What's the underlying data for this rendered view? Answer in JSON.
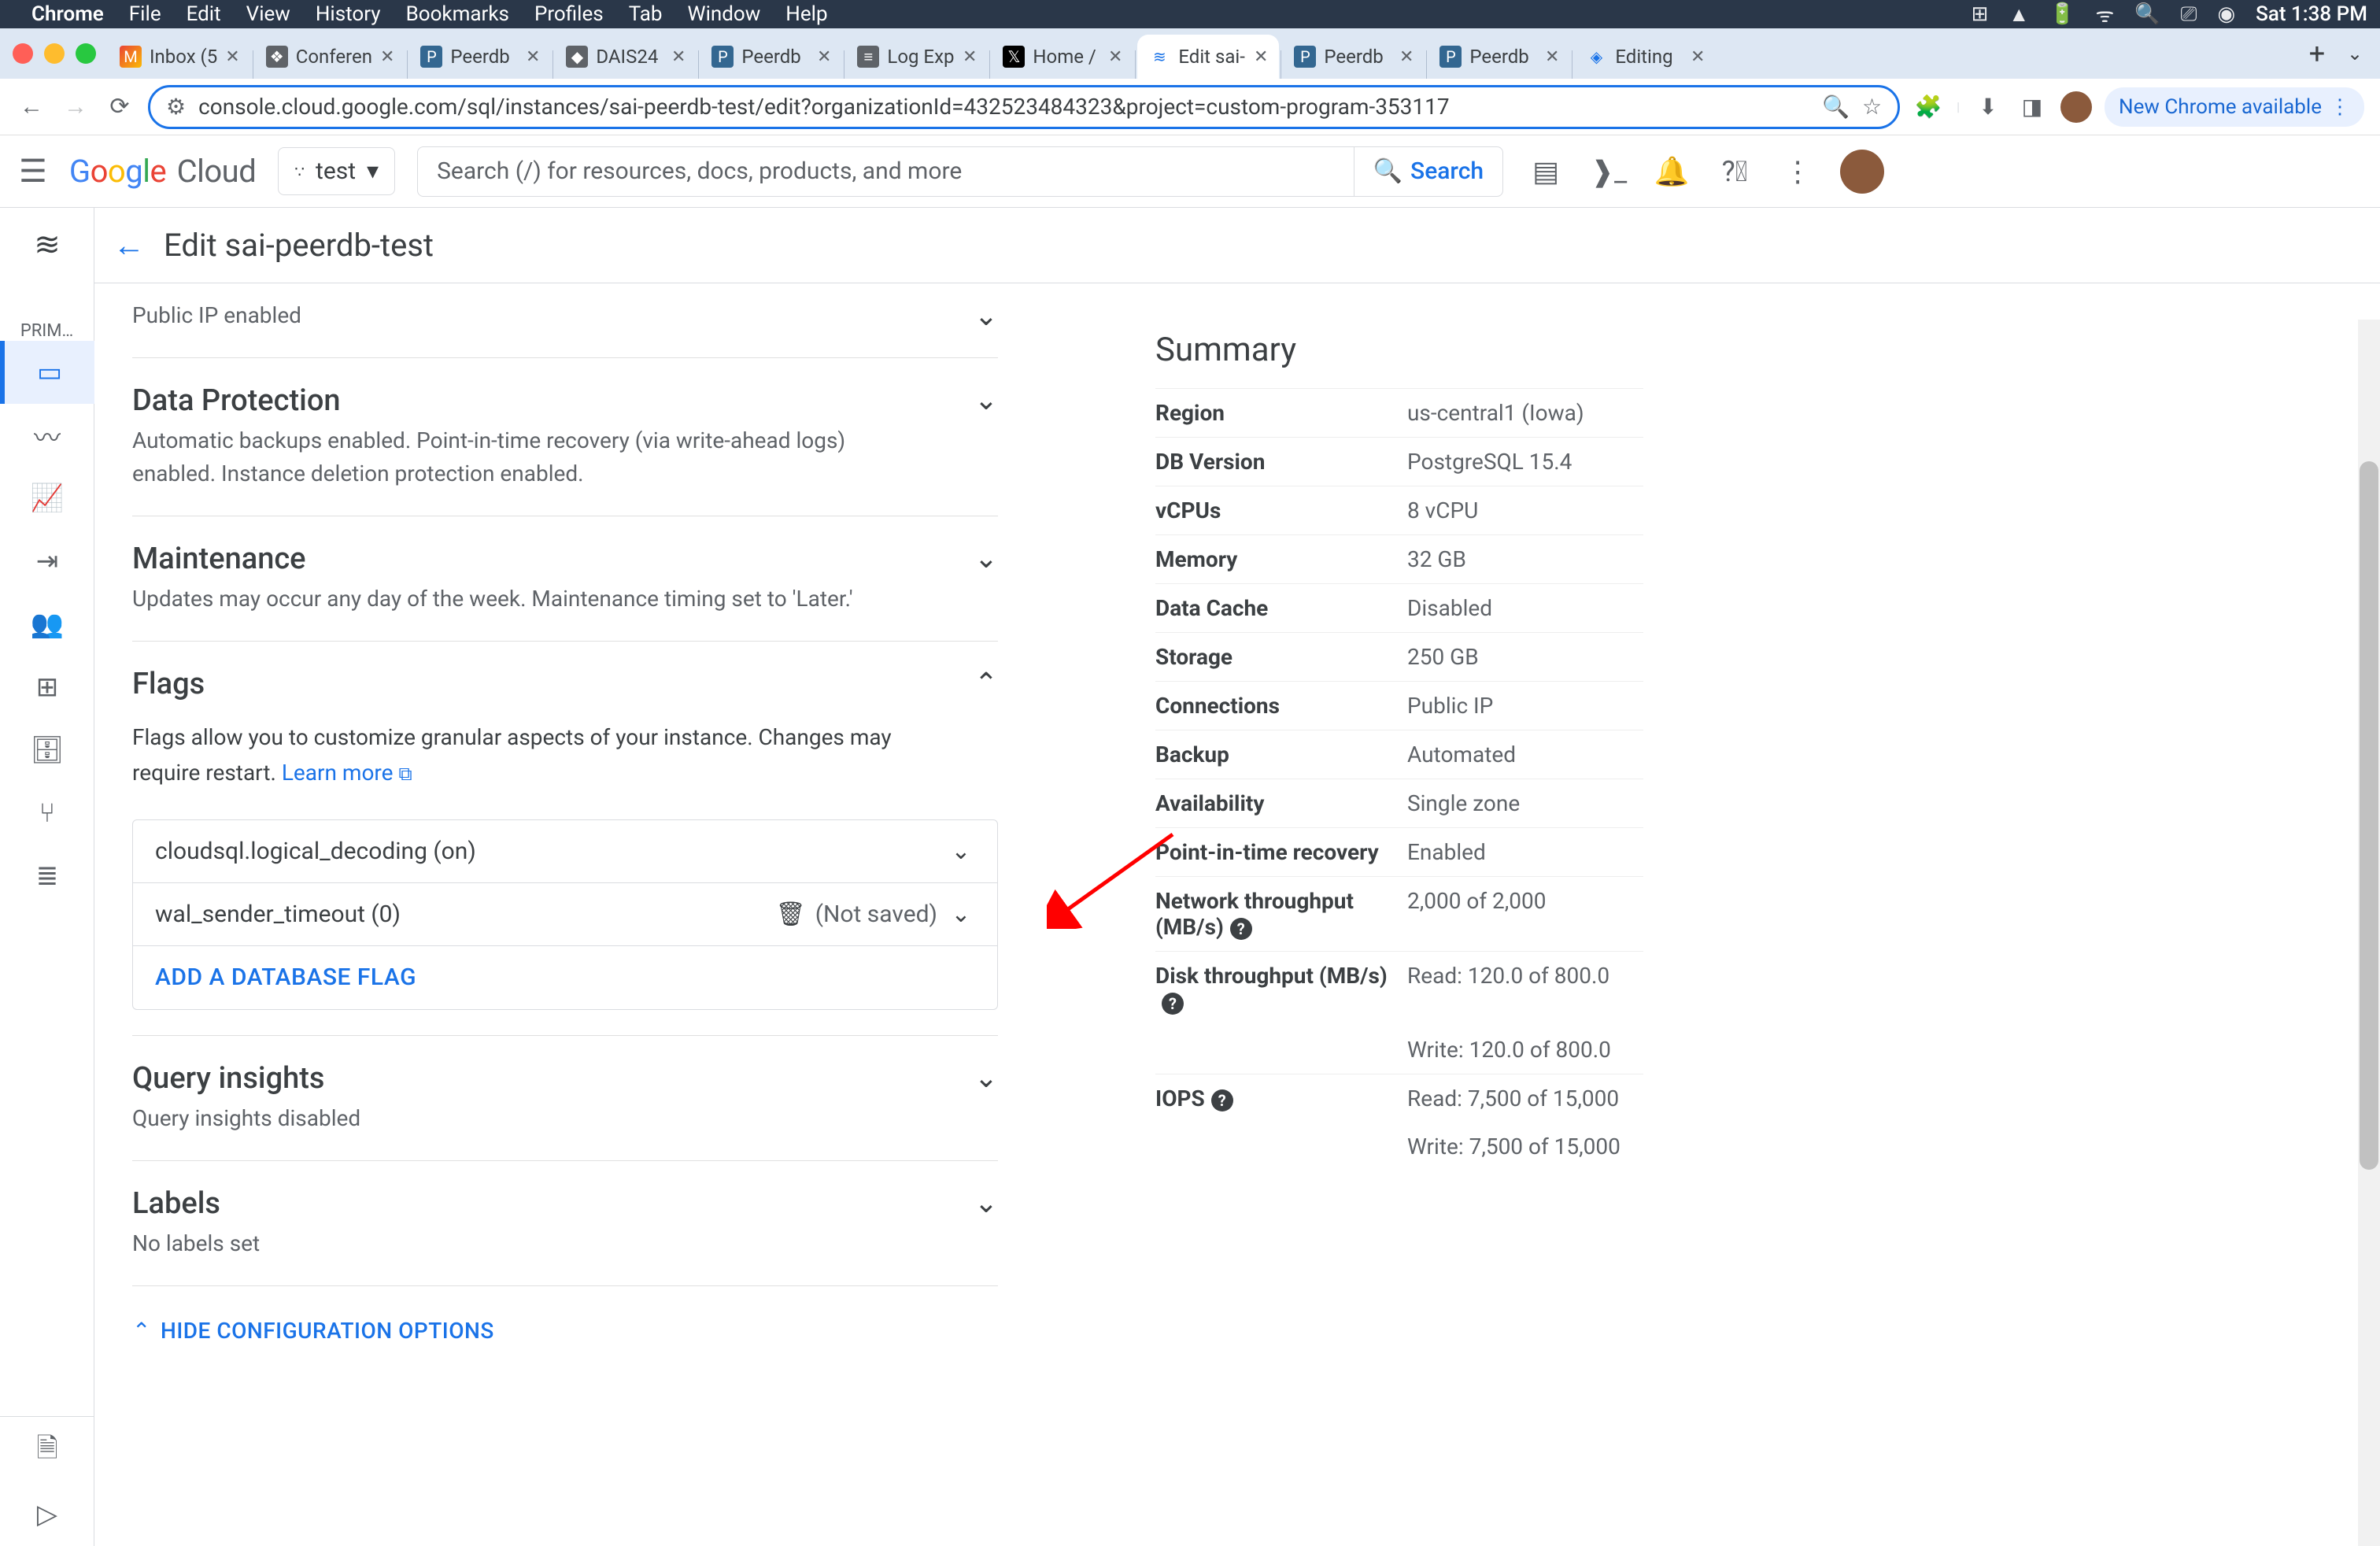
{
  "mac_menu": {
    "app": "Chrome",
    "items": [
      "File",
      "Edit",
      "View",
      "History",
      "Bookmarks",
      "Profiles",
      "Tab",
      "Window",
      "Help"
    ],
    "clock": "Sat 1:38 PM"
  },
  "tabs": [
    {
      "label": "Inbox (5",
      "fav": "fav-gmail",
      "glyph": "M"
    },
    {
      "label": "Conferen",
      "fav": "fav-gen",
      "glyph": "❖"
    },
    {
      "label": "Peerdb",
      "fav": "fav-pg",
      "glyph": "P"
    },
    {
      "label": "DAIS24",
      "fav": "fav-gen",
      "glyph": "◆"
    },
    {
      "label": "Peerdb",
      "fav": "fav-pg",
      "glyph": "P"
    },
    {
      "label": "Log Exp",
      "fav": "fav-gen",
      "glyph": "≡"
    },
    {
      "label": "Home /",
      "fav": "fav-x",
      "glyph": "𝕏"
    },
    {
      "label": "Edit sai-",
      "fav": "fav-gcp",
      "glyph": "≋",
      "active": true
    },
    {
      "label": "Peerdb",
      "fav": "fav-pg",
      "glyph": "P"
    },
    {
      "label": "Peerdb",
      "fav": "fav-pg",
      "glyph": "P"
    },
    {
      "label": "Editing",
      "fav": "fav-ch",
      "glyph": "◈"
    }
  ],
  "omnibox": {
    "url": "console.cloud.google.com/sql/instances/sai-peerdb-test/edit?organizationId=432523484323&project=custom-program-353117"
  },
  "chrome_update": "New Chrome available",
  "gcp": {
    "project": "test",
    "search_placeholder": "Search (/) for resources, docs, products, and more",
    "search_button": "Search"
  },
  "page": {
    "title": "Edit sai-peerdb-test",
    "rail_label": "PRIM…"
  },
  "sections": {
    "public_ip": "Public IP enabled",
    "data_protection": {
      "title": "Data Protection",
      "sub": "Automatic backups enabled. Point-in-time recovery (via write-ahead logs) enabled. Instance deletion protection enabled."
    },
    "maintenance": {
      "title": "Maintenance",
      "sub": "Updates may occur any day of the week. Maintenance timing set to 'Later.'"
    },
    "flags": {
      "title": "Flags",
      "desc_pre": "Flags allow you to customize granular aspects of your instance. Changes may require restart. ",
      "learn_more": "Learn more",
      "rows": [
        {
          "name": "cloudsql.logical_decoding (on)"
        },
        {
          "name": "wal_sender_timeout (0)",
          "unsaved": "(Not saved)",
          "deletable": true
        }
      ],
      "add": "ADD A DATABASE FLAG"
    },
    "query_insights": {
      "title": "Query insights",
      "sub": "Query insights disabled"
    },
    "labels": {
      "title": "Labels",
      "sub": "No labels set"
    },
    "hide_config": "HIDE CONFIGURATION OPTIONS"
  },
  "summary": {
    "title": "Summary",
    "rows": [
      {
        "k": "Region",
        "v": "us-central1 (Iowa)"
      },
      {
        "k": "DB Version",
        "v": "PostgreSQL 15.4"
      },
      {
        "k": "vCPUs",
        "v": "8 vCPU"
      },
      {
        "k": "Memory",
        "v": "32 GB"
      },
      {
        "k": "Data Cache",
        "v": "Disabled"
      },
      {
        "k": "Storage",
        "v": "250 GB"
      },
      {
        "k": "Connections",
        "v": "Public IP"
      },
      {
        "k": "Backup",
        "v": "Automated"
      },
      {
        "k": "Availability",
        "v": "Single zone"
      },
      {
        "k": "Point-in-time recovery",
        "v": "Enabled"
      },
      {
        "k": "Network throughput (MB/s)",
        "v": "2,000 of 2,000",
        "help": true
      },
      {
        "k": "Disk throughput (MB/s)",
        "v": "Read: 120.0 of 800.0",
        "help": true
      },
      {
        "k": "",
        "v": "Write: 120.0 of 800.0"
      },
      {
        "k": "IOPS",
        "v": "Read: 7,500 of 15,000",
        "help": true
      },
      {
        "k": "",
        "v": "Write: 7,500 of 15,000"
      }
    ]
  }
}
